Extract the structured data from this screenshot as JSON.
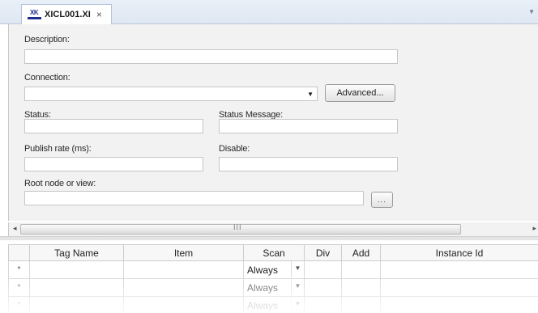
{
  "tab": {
    "icon_text": "XK",
    "title": "XICL001.XI",
    "close_glyph": "×",
    "menu_glyph": "▼"
  },
  "form": {
    "description_label": "Description:",
    "description_value": "",
    "connection_label": "Connection:",
    "connection_value": "",
    "advanced_button": "Advanced...",
    "status_label": "Status:",
    "status_value": "",
    "status_message_label": "Status Message:",
    "status_message_value": "",
    "publish_rate_label": "Publish rate (ms):",
    "publish_rate_value": "",
    "disable_label": "Disable:",
    "disable_value": "",
    "root_node_label": "Root node or view:",
    "root_node_value": "",
    "browse_button": "..."
  },
  "scrollbar": {
    "grip": "III",
    "left_arrow": "◂",
    "right_arrow": "▸"
  },
  "grid": {
    "columns": [
      "Tag Name",
      "Item",
      "Scan",
      "Div",
      "Add",
      "Instance Id"
    ],
    "rows": [
      {
        "marker": "*",
        "tag_name": "",
        "item": "",
        "scan": "Always",
        "div": "",
        "add": "",
        "instance_id": ""
      },
      {
        "marker": "*",
        "tag_name": "",
        "item": "",
        "scan": "Always",
        "div": "",
        "add": "",
        "instance_id": ""
      },
      {
        "marker": "*",
        "tag_name": "",
        "item": "",
        "scan": "Always",
        "div": "",
        "add": "",
        "instance_id": ""
      }
    ]
  }
}
